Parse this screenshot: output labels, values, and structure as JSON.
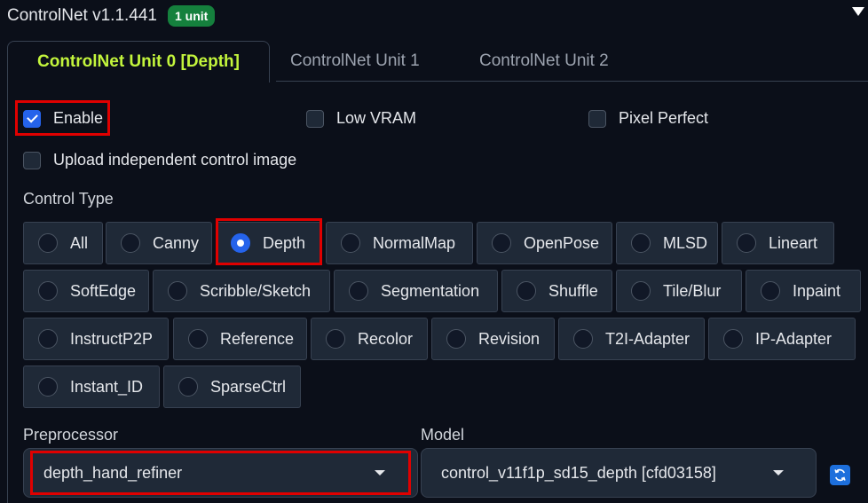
{
  "header": {
    "title": "ControlNet v1.1.441",
    "badge": "1 unit"
  },
  "tabs": [
    {
      "label": "ControlNet Unit 0 [Depth]",
      "active": true
    },
    {
      "label": "ControlNet Unit 1",
      "active": false
    },
    {
      "label": "ControlNet Unit 2",
      "active": false
    }
  ],
  "options": {
    "enable": {
      "label": "Enable",
      "checked": true
    },
    "low_vram": {
      "label": "Low VRAM",
      "checked": false
    },
    "pixel_perfect": {
      "label": "Pixel Perfect",
      "checked": false
    },
    "upload_independent": {
      "label": "Upload independent control image",
      "checked": false
    }
  },
  "control_type": {
    "label": "Control Type",
    "selected": "Depth",
    "options": [
      "All",
      "Canny",
      "Depth",
      "NormalMap",
      "OpenPose",
      "MLSD",
      "Lineart",
      "SoftEdge",
      "Scribble/Sketch",
      "Segmentation",
      "Shuffle",
      "Tile/Blur",
      "Inpaint",
      "InstructP2P",
      "Reference",
      "Recolor",
      "Revision",
      "T2I-Adapter",
      "IP-Adapter",
      "Instant_ID",
      "SparseCtrl"
    ]
  },
  "preprocessor": {
    "label": "Preprocessor",
    "value": "depth_hand_refiner"
  },
  "model": {
    "label": "Model",
    "value": "control_v11f1p_sd15_depth [cfd03158]"
  },
  "colors": {
    "accent": "#c3f53c",
    "badge": "#15803d",
    "highlight": "#e00000",
    "checkbox": "#2563eb"
  }
}
